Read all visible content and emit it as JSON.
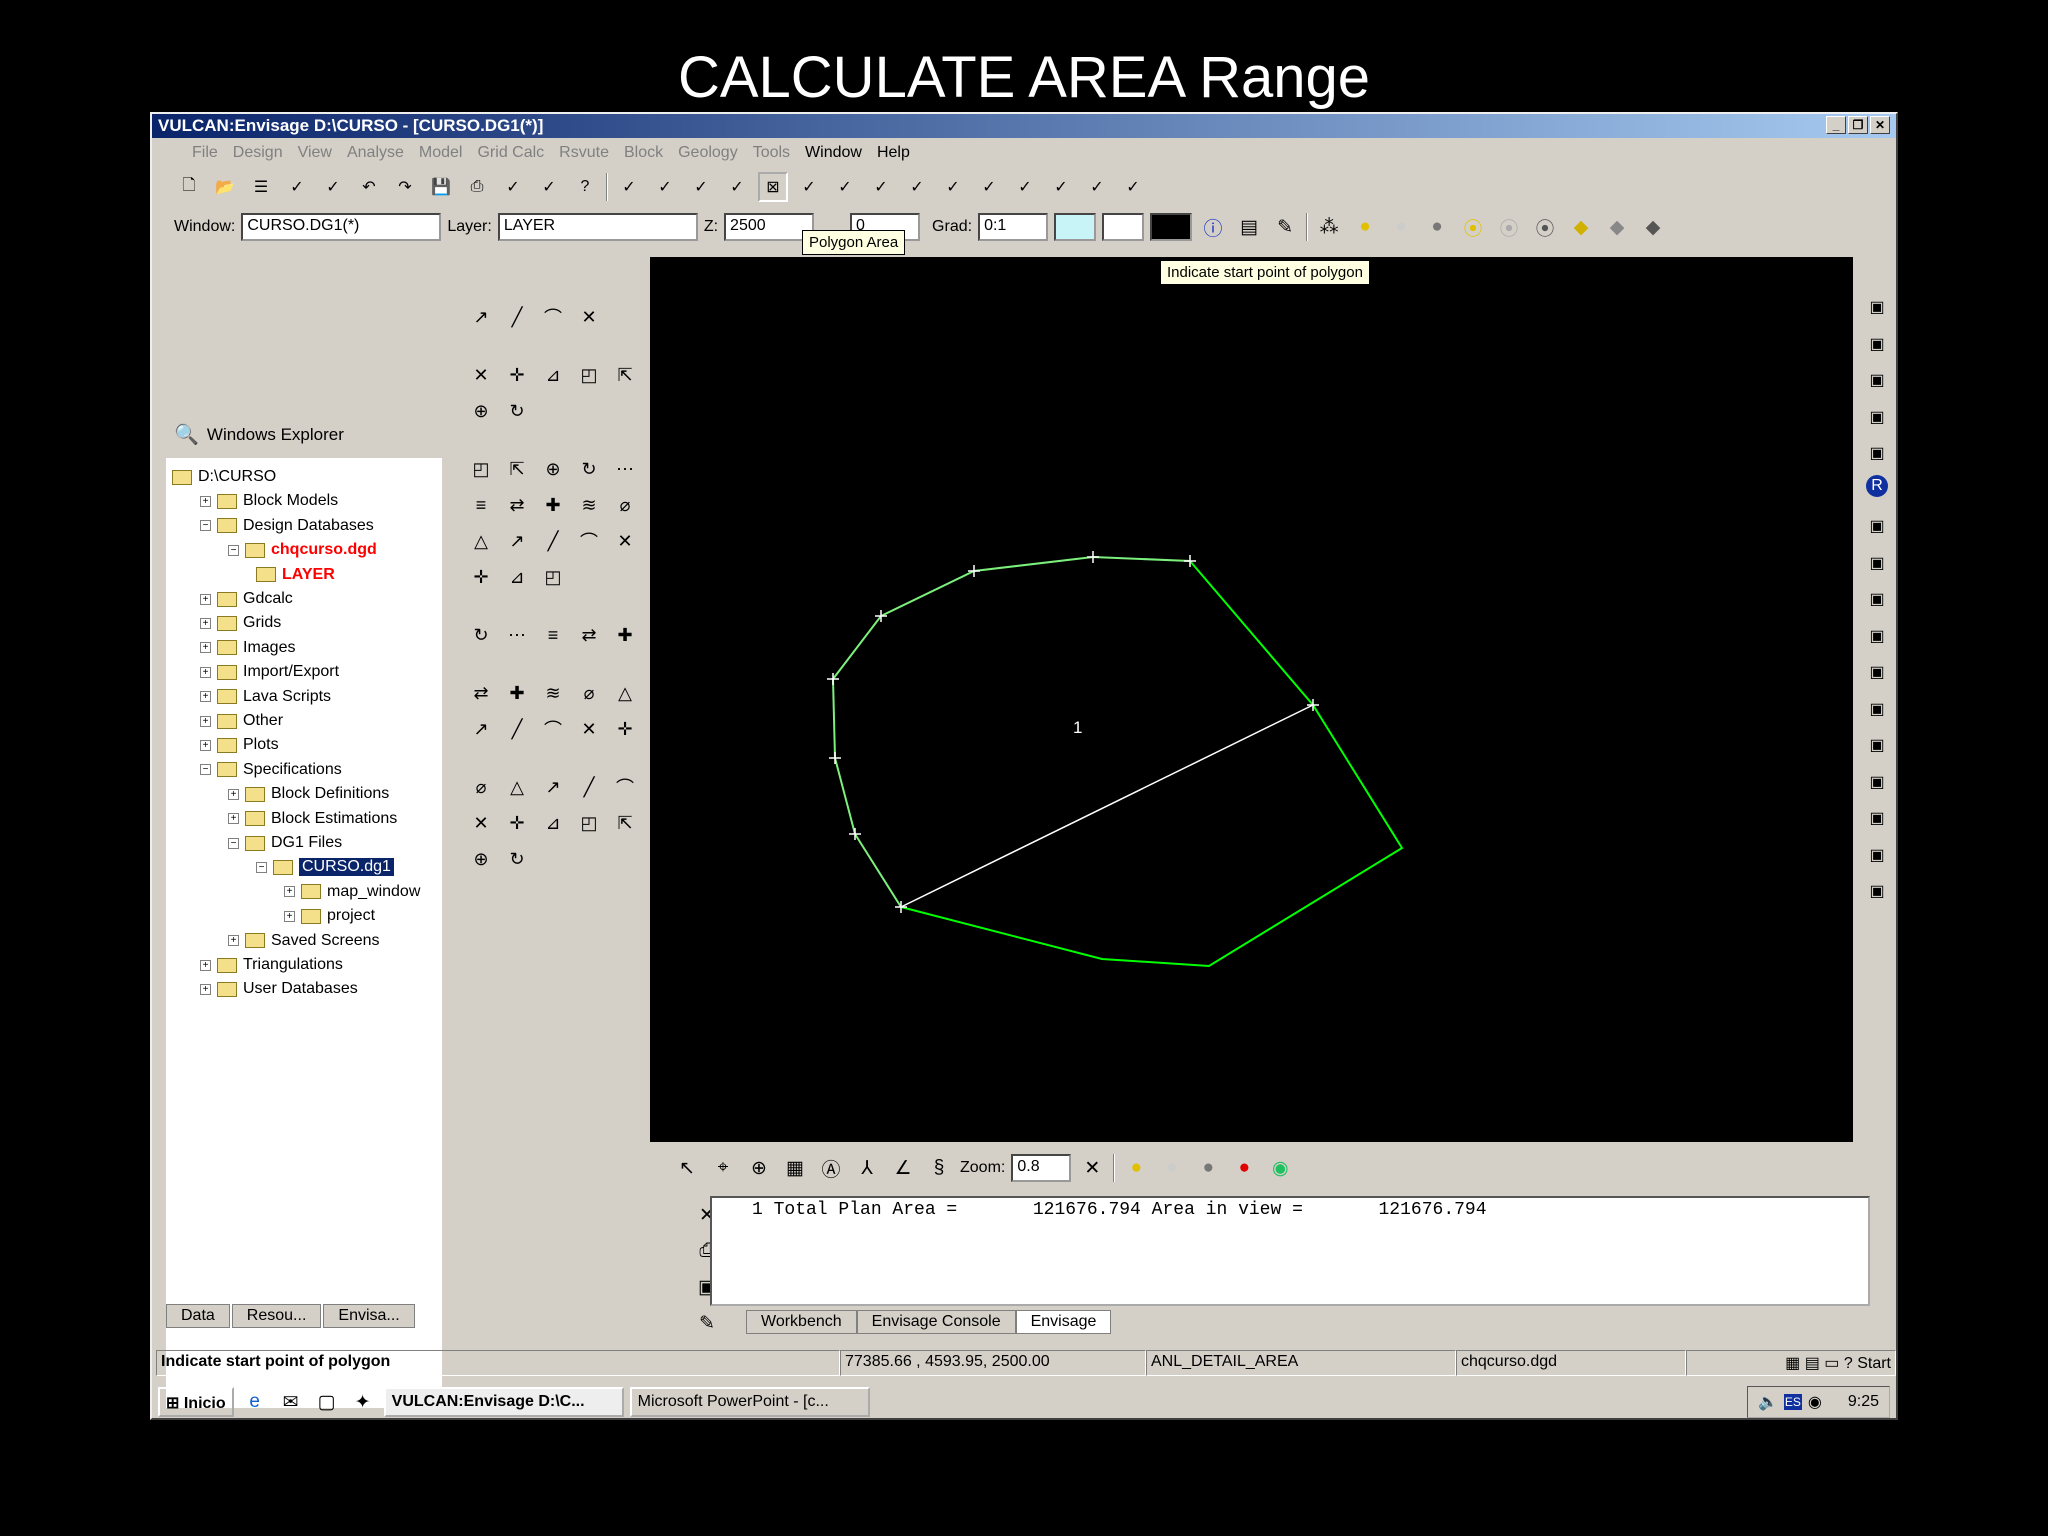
{
  "slide_title": "CALCULATE AREA Range",
  "window": {
    "title": "VULCAN:Envisage  D:\\CURSO - [CURSO.DG1(*)]"
  },
  "menu": [
    "File",
    "Design",
    "View",
    "Analyse",
    "Model",
    "Grid Calc",
    "Rsvute",
    "Block",
    "Geology",
    "Tools",
    "Window",
    "Help"
  ],
  "toolbar1_icons": [
    "new-icon",
    "open-icon",
    "layers-icon",
    "delete-layer-icon",
    "delete-point-icon",
    "undo-icon",
    "redo-icon",
    "save-icon",
    "print-icon",
    "copy-window-icon",
    "close-window-icon",
    "help-icon",
    "coordinate-query-icon",
    "distance-query-icon",
    "bearing-query-icon",
    "gradient-query-icon",
    "polygon-area-icon",
    "circle-query-icon",
    "angle-query-icon",
    "intersect-query-icon",
    "slope-query-icon",
    "object-info-icon",
    "object-bounds-icon",
    "text-query-icon",
    "color-query-icon",
    "report-query-icon",
    "delete-query-icon"
  ],
  "toolbar2": {
    "window_label": "Window:",
    "window_value": "CURSO.DG1(*)",
    "layer_label": "Layer:",
    "layer_value": "LAYER",
    "z_label": "Z:",
    "z_value": "2500",
    "second_value": "0",
    "grad_label": "Grad:",
    "grad_value": "0:1"
  },
  "tooltips": {
    "polygon_area": "Polygon Area",
    "start_point": "Indicate start point of polygon"
  },
  "explorer": {
    "title": "Windows Explorer",
    "items": [
      {
        "label": "D:\\CURSO",
        "level": 0
      },
      {
        "label": "Block Models",
        "level": 1,
        "pm": "+"
      },
      {
        "label": "Design Databases",
        "level": 1,
        "pm": "-"
      },
      {
        "label": "chqcurso.dgd",
        "level": 2,
        "pm": "-",
        "red": true
      },
      {
        "label": "LAYER",
        "level": 3,
        "red": true
      },
      {
        "label": "Gdcalc",
        "level": 1,
        "pm": "+"
      },
      {
        "label": "Grids",
        "level": 1,
        "pm": "+"
      },
      {
        "label": "Images",
        "level": 1,
        "pm": "+"
      },
      {
        "label": "Import/Export",
        "level": 1,
        "pm": "+"
      },
      {
        "label": "Lava Scripts",
        "level": 1,
        "pm": "+"
      },
      {
        "label": "Other",
        "level": 1,
        "pm": "+"
      },
      {
        "label": "Plots",
        "level": 1,
        "pm": "+"
      },
      {
        "label": "Specifications",
        "level": 1,
        "pm": "-"
      },
      {
        "label": "Block Definitions",
        "level": 2,
        "pm": "+"
      },
      {
        "label": "Block Estimations",
        "level": 2,
        "pm": "+"
      },
      {
        "label": "DG1 Files",
        "level": 2,
        "pm": "-"
      },
      {
        "label": "CURSO.dg1",
        "level": 3,
        "pm": "-",
        "selected": true
      },
      {
        "label": "map_window",
        "level": 4,
        "pm": "+"
      },
      {
        "label": "project",
        "level": 4,
        "pm": "+"
      },
      {
        "label": "Saved Screens",
        "level": 2,
        "pm": "+"
      },
      {
        "label": "Triangulations",
        "level": 1,
        "pm": "+"
      },
      {
        "label": "User Databases",
        "level": 1,
        "pm": "+"
      }
    ],
    "tabs": [
      "Data",
      "Resou...",
      "Envisa..."
    ]
  },
  "canvas": {
    "polygon_label": "1",
    "line_color": "#00ff00",
    "chord_color": "#ffffff"
  },
  "bottom_toolbar": {
    "zoom_label": "Zoom:",
    "zoom_value": "0.8"
  },
  "output": {
    "line": "1 Total Plan Area =       121676.794 Area in view =       121676.794",
    "tabs": [
      "Workbench",
      "Envisage Console",
      "Envisage"
    ]
  },
  "status": {
    "prompt": "Indicate start point of polygon",
    "coords": "77385.66 , 4593.95, 2500.00",
    "function": "ANL_DETAIL_AREA",
    "database": "chqcurso.dgd",
    "start": "Start"
  },
  "taskbar": {
    "start": "Inicio",
    "tasks": [
      "VULCAN:Envisage  D:\\C...",
      "Microsoft PowerPoint - [c..."
    ],
    "clock": "9:25",
    "lang": "ES"
  }
}
